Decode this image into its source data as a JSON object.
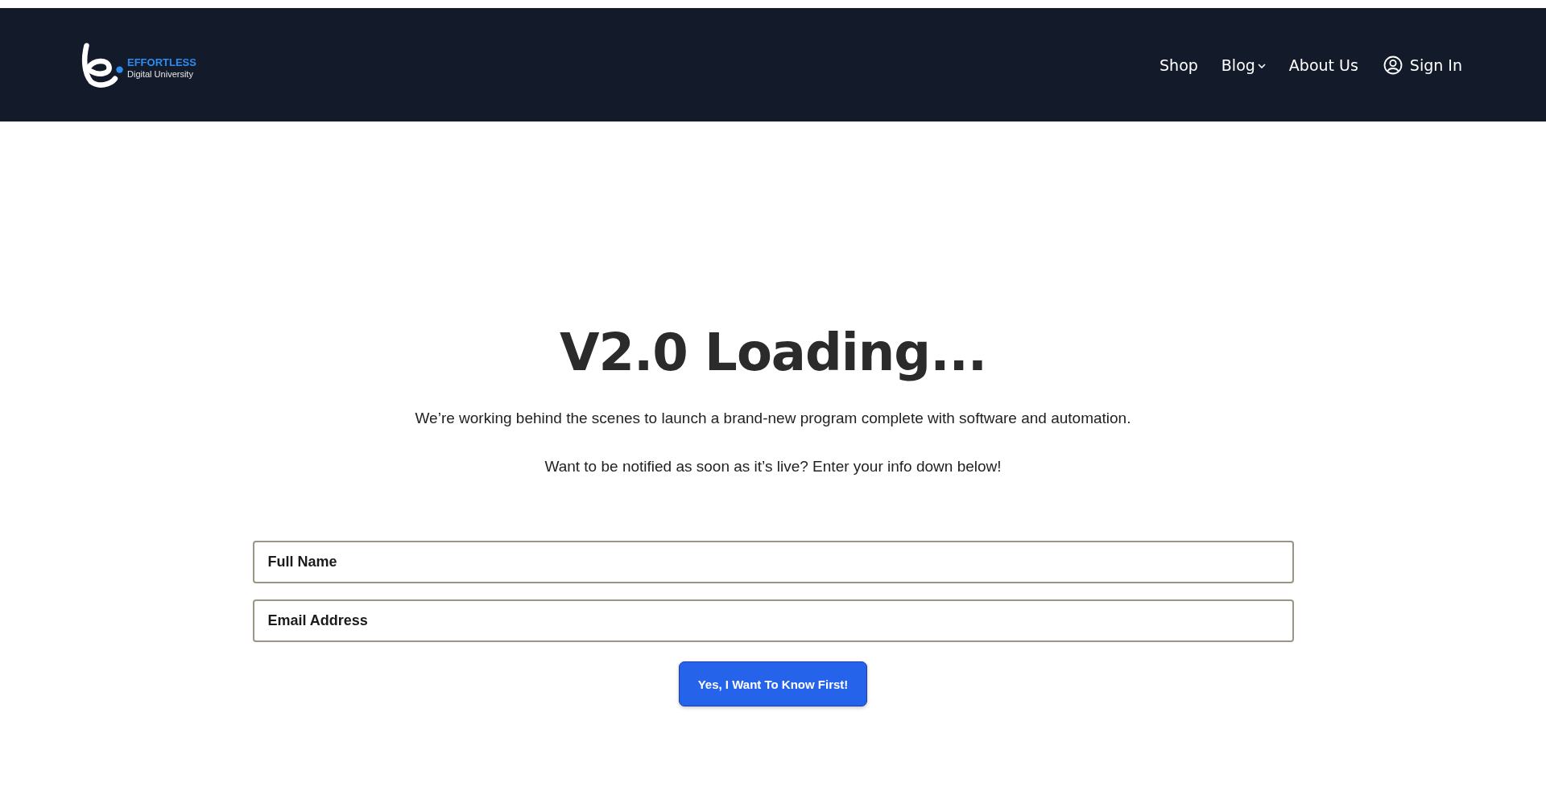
{
  "header": {
    "logo": {
      "brand": "EFFORTLESS",
      "tagline": "Digital University"
    },
    "nav": [
      {
        "label": "Shop",
        "kind": "link"
      },
      {
        "label": "Blog",
        "kind": "dropdown"
      },
      {
        "label": "About Us",
        "kind": "link"
      },
      {
        "label": "Sign In",
        "kind": "account"
      }
    ]
  },
  "hero": {
    "title": "V2.0 Loading...",
    "paragraphs": [
      "We’re working behind the scenes to launch a brand-new program complete with software and automation.",
      "Want to be notified as soon as it’s live? Enter your info down below!"
    ]
  },
  "form": {
    "fields": [
      {
        "placeholder": "Full Name"
      },
      {
        "placeholder": "Email Address"
      }
    ],
    "submit": "Yes, I Want To Know First!"
  }
}
